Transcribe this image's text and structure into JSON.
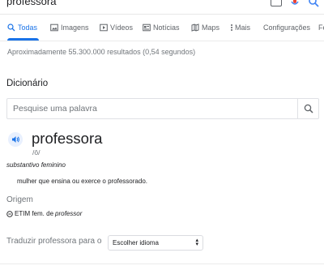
{
  "search": {
    "query": "professora"
  },
  "tabs": [
    {
      "label": "Todas",
      "icon": "search-icon",
      "active": true
    },
    {
      "label": "Imagens",
      "icon": "image-icon",
      "active": false
    },
    {
      "label": "Vídeos",
      "icon": "play-icon",
      "active": false
    },
    {
      "label": "Notícias",
      "icon": "news-icon",
      "active": false
    },
    {
      "label": "Maps",
      "icon": "map-icon",
      "active": false
    },
    {
      "label": "Mais",
      "icon": "more-vertical-icon",
      "active": false
    },
    {
      "label": "Configurações",
      "active": false
    },
    {
      "label": "Fe",
      "active": false
    }
  ],
  "results_stats": "Aproximadamente 55.300.000 resultados (0,54 segundos)",
  "dictionary": {
    "title": "Dicionário",
    "search_placeholder": "Pesquise uma palavra",
    "headword": "professora",
    "phonetic": "/ô/",
    "part_of_speech": "substantivo feminino",
    "definition": "mulher que ensina ou exerce o professorado.",
    "origin_title": "Origem",
    "origin_prefix": "ETIM fem. de",
    "origin_word": "professor",
    "translate_label": "Traduzir professora para o",
    "language_select": "Escolher idioma"
  },
  "colors": {
    "accent": "#1a73e8",
    "secondary_text": "#70757a"
  }
}
